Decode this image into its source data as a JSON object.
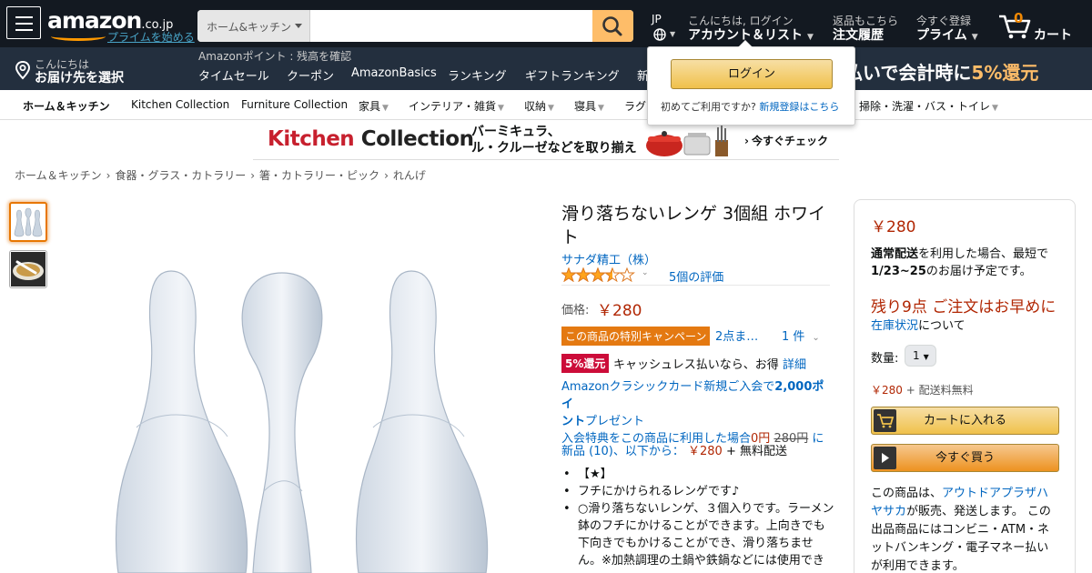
{
  "nav": {
    "logo": "amazon",
    "logo_suffix": ".co.jp",
    "prime_link": "プライムを始める",
    "search_category": "ホーム&キッチン",
    "search_placeholder": "",
    "lang": "JP",
    "account_line1": "こんにちは, ログイン",
    "account_line2": "アカウント＆リスト",
    "orders_line1": "返品もこちら",
    "orders_line2": "注文履歴",
    "prime_line1": "今すぐ登録",
    "prime_line2": "プライム",
    "cart_count": "0",
    "cart_label": "カート",
    "deliver_line1": "こんにちは",
    "deliver_line2": "お届け先を選択",
    "points": "Amazonポイント : 残高を確認",
    "sub_links": [
      "タイムセール",
      "クーポン",
      "AmazonBasics",
      "ランキング",
      "ギフトランキング",
      "新"
    ],
    "promo_text": "払いで会計時に",
    "promo_pct": "5%還元"
  },
  "catbar": {
    "items": [
      "ホーム＆キッチン",
      "Kitchen Collection",
      "Furniture Collection",
      "家具",
      "インテリア・雑貨",
      "収納",
      "寝具",
      "ラグ",
      "掃除・洗濯・バス・トイレ"
    ]
  },
  "signin": {
    "button": "ログイン",
    "new_text": "初めてご利用ですか?",
    "new_link": "新規登録はこちら"
  },
  "banner": {
    "brand": "Kitchen Collection",
    "copy1": "バーミキュラ、",
    "copy2": "ル・クルーゼなどを取り揃え",
    "cta": "今すぐチェック"
  },
  "breadcrumb": [
    "ホーム＆キッチン",
    "食器・グラス・カトラリー",
    "箸・カトラリー・ピック",
    "れんげ"
  ],
  "product": {
    "title_l1": "滑り落ちないレンゲ 3個組 ホワイ",
    "title_l2": "ト",
    "brand": "サナダ精工（株）",
    "rating": 3.5,
    "reviews": "5個の評価",
    "price_label": "価格:",
    "price": "￥280",
    "campaign": "この商品の特別キャンペーン",
    "campaign_more": "2点ま…",
    "campaign_count": "1 件",
    "cashback_badge": "5%還元",
    "cashback_text": "キャッシュレス払いなら、お得",
    "cashback_link": "詳細",
    "card_l1a": "Amazonクラシックカード新規ご入会で",
    "card_l1b": "2,000ポイ",
    "card_l2a": "ント",
    "card_l2b": "プレゼント",
    "card_l3a": "入会特典をこの商品に利用した場合",
    "card_l3b": "0円",
    "card_l3c": "280円",
    "card_l3d": "に",
    "new_from": "新品 (10)、以下から：",
    "new_price": "￥280",
    "new_shipping": "+ 無料配送",
    "bullets": [
      "【★】",
      "フチにかけられるレンゲです♪",
      "○滑り落ちないレンゲ、３個入りです。ラーメン鉢のフチにかけることができます。上向きでも下向きでもかけることができ、滑り落ちません。※加熱調理の土鍋や鉄鍋などには使用でき"
    ]
  },
  "buybox": {
    "price": "￥280",
    "delivery_a": "通常配送",
    "delivery_b": "を利用した場合、最短で",
    "delivery_date": "1/23~25",
    "delivery_c": "のお届け予定です。",
    "stock": "残り9点 ご注文はお早めに",
    "stock_link": "在庫状況",
    "stock_suffix": "について",
    "qty_label": "数量:",
    "qty_value": "1",
    "ship_price": "￥280",
    "ship_text": "+ 配送料無料",
    "cart_button": "カートに入れる",
    "buy_button": "今すぐ買う",
    "seller_a": "この商品は、",
    "seller_link_1": "アウトドアプラザハ",
    "seller_link_2": "ヤサカ",
    "seller_b": "が販売、発送します。 この",
    "seller_c": "出品商品にはコンビニ・ATM・ネ",
    "seller_d": "ットバンキング・電子マネー払い",
    "seller_e": "が利用できます。"
  },
  "colors": {
    "nav_dark": "#131921",
    "nav_sub": "#232f3e",
    "accent": "#ff9900",
    "price": "#b12704",
    "link": "#0066c0"
  }
}
